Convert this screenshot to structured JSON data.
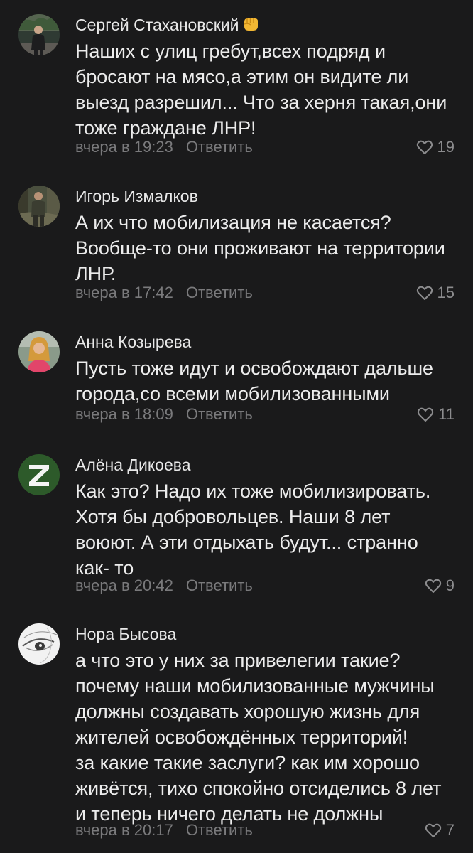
{
  "reply_label": "Ответить",
  "comments": [
    {
      "author": "Сергей Стахановский",
      "author_badge": "fist-emoji-icon",
      "lines": [
        "Наших с улиц гребут,всех подряд и",
        "бросают на мясо,а этим он видите ли",
        "выезд разрешил... Что за херня такая,они",
        "тоже граждане ЛНР!"
      ],
      "time": "вчера в 19:23",
      "likes": "19"
    },
    {
      "author": "Игорь Измалков",
      "lines": [
        "А их что мобилизация не касается?",
        "Вообще-то они проживают на территории",
        "ЛНР."
      ],
      "time": "вчера в 17:42",
      "likes": "15"
    },
    {
      "author": "Анна Козырева",
      "lines": [
        "Пусть тоже идут и освобождают дальше",
        "города,со всеми мобилизованными"
      ],
      "time": "вчера в 18:09",
      "likes": "11"
    },
    {
      "author": "Алёна Дикоева",
      "lines": [
        "Как это? Надо их тоже мобилизировать.",
        "Хотя бы добровольцев. Наши 8 лет",
        "воюют. А эти отдыхать будут... странно",
        "как- то"
      ],
      "time": "вчера в 20:42",
      "likes": "9"
    },
    {
      "author": "Нора Бысова",
      "lines": [
        "а что это у них за привелегии такие?",
        "почему наши мобилизованные мужчины",
        "должны создавать хорошую жизнь для",
        "жителей освобождённых территорий!",
        "за какие такие заслуги? как им хорошо",
        "живётся, тихо спокойно отсиделись 8 лет",
        "и теперь ничего делать не должны"
      ],
      "time": "вчера в 20:17",
      "likes": "7"
    }
  ],
  "colors": {
    "background": "#1a1a1b",
    "text": "#ececec",
    "meta": "#7a7a7c"
  }
}
